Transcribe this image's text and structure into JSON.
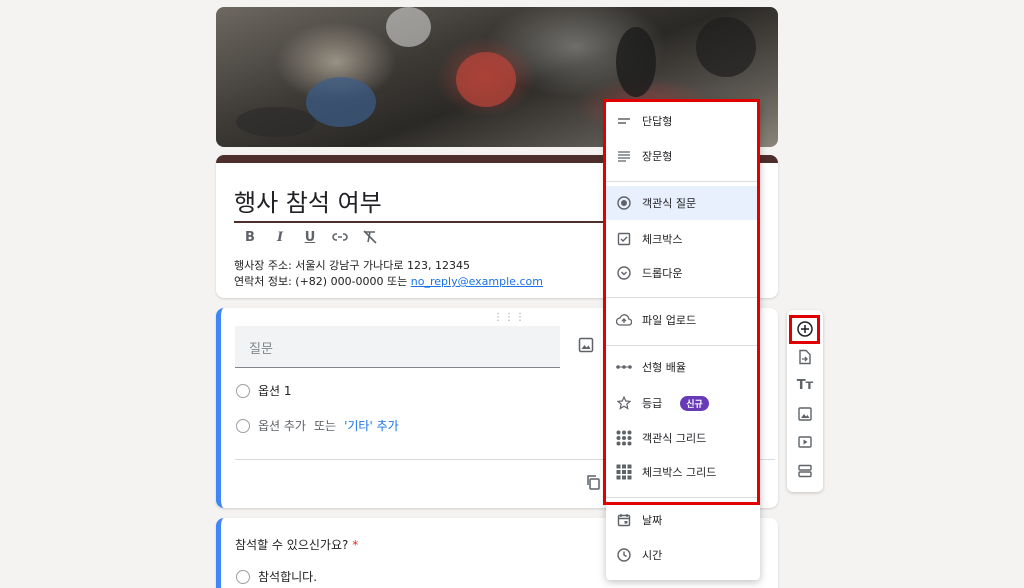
{
  "form": {
    "title": "행사 참석 여부",
    "description_line1": "행사장 주소: 서울시 강남구 가나다로 123, 12345",
    "description_line2_prefix": "연락처 정보: (+82) 000-0000 또는 ",
    "description_email": "no_reply@example.com"
  },
  "format_toolbar": {
    "bold": "B",
    "italic": "I",
    "underline": "U"
  },
  "question1": {
    "placeholder": "질문",
    "option1": "옵션 1",
    "add_option": "옵션 추가",
    "or_text": "또는",
    "add_other": "'기타' 추가"
  },
  "question2": {
    "title": "참석할 수 있으신가요?",
    "required_mark": "*",
    "option1": "참석합니다."
  },
  "type_menu": {
    "items": [
      {
        "label": "단답형",
        "icon": "short-answer-icon"
      },
      {
        "label": "장문형",
        "icon": "paragraph-icon"
      },
      {
        "label": "객관식 질문",
        "icon": "radio-icon",
        "selected": true
      },
      {
        "label": "체크박스",
        "icon": "checkbox-icon"
      },
      {
        "label": "드롭다운",
        "icon": "dropdown-icon"
      },
      {
        "label": "파일 업로드",
        "icon": "cloud-upload-icon"
      },
      {
        "label": "선형 배율",
        "icon": "linear-scale-icon"
      },
      {
        "label": "등급",
        "icon": "star-icon",
        "badge": "신규"
      },
      {
        "label": "객관식 그리드",
        "icon": "radio-grid-icon"
      },
      {
        "label": "체크박스 그리드",
        "icon": "checkbox-grid-icon"
      },
      {
        "label": "날짜",
        "icon": "calendar-icon"
      },
      {
        "label": "시간",
        "icon": "clock-icon"
      }
    ]
  },
  "colors": {
    "theme": "#4e2e2a",
    "accent": "#4285f4",
    "link": "#1a73e8",
    "highlight": "#e00000",
    "badge": "#673ab7",
    "required": "#d93025"
  }
}
